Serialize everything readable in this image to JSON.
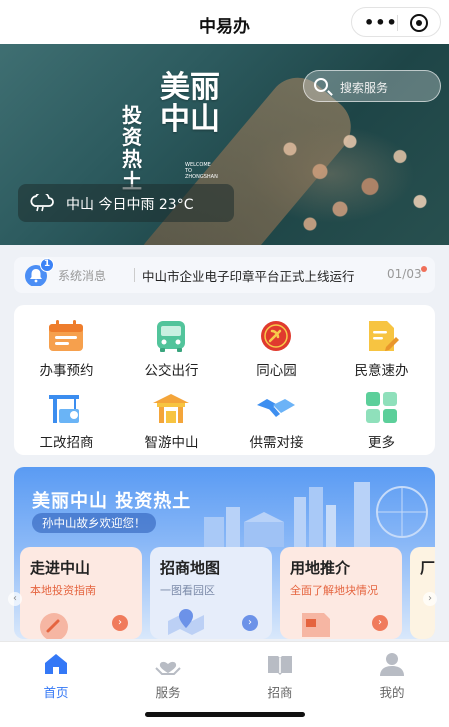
{
  "topbar": {
    "title": "中易办",
    "more_icon": "more-dots-icon",
    "close_icon": "target-circle-icon"
  },
  "hero": {
    "calligraphy_main": "美丽中山",
    "calligraphy_side": "投资热土",
    "welcome_text": "WELCOME TO ZHONGSHAN",
    "search_placeholder": "搜索服务",
    "weather": {
      "icon": "rain-cloud-icon",
      "text": "中山  今日中雨  23°C"
    }
  },
  "notice": {
    "badge": "1",
    "label": "系统消息",
    "text": "中山市企业电子印章平台正式上线运行",
    "page": "01/03",
    "accent": "#f0705a"
  },
  "services": [
    {
      "label": "办事预约",
      "icon": "calendar-icon"
    },
    {
      "label": "公交出行",
      "icon": "bus-icon"
    },
    {
      "label": "同心园",
      "icon": "party-emblem-icon"
    },
    {
      "label": "民意速办",
      "icon": "document-pen-icon"
    },
    {
      "label": "工改招商",
      "icon": "crane-icon"
    },
    {
      "label": "智游中山",
      "icon": "pavilion-icon"
    },
    {
      "label": "供需对接",
      "icon": "handshake-icon"
    },
    {
      "label": "更多",
      "icon": "grid-more-icon"
    }
  ],
  "banner": {
    "title": "美丽中山 投资热土",
    "subtitle": "孙中山故乡欢迎您！",
    "cards": [
      {
        "title": "走进中山",
        "subtitle": "本地投资指南",
        "sub_color": "#e5643f",
        "bg": "#fde9e2",
        "arrow_color": "#f07b5c"
      },
      {
        "title": "招商地图",
        "subtitle": "一图看园区",
        "sub_color": "#7b8aa8",
        "bg": "#e6edfa",
        "arrow_color": "#6c92e8"
      },
      {
        "title": "用地推介",
        "subtitle": "全面了解地块情况",
        "sub_color": "#e5643f",
        "bg": "#fde9e2",
        "arrow_color": "#f07b5c"
      },
      {
        "title": "厂",
        "subtitle": "",
        "sub_color": "#e5643f",
        "bg": "#fdf3e2",
        "arrow_color": "#f0a55c"
      }
    ]
  },
  "tabs": [
    {
      "label": "首页",
      "icon": "home-icon",
      "active": true
    },
    {
      "label": "服务",
      "icon": "service-hands-icon",
      "active": false
    },
    {
      "label": "招商",
      "icon": "investment-book-icon",
      "active": false
    },
    {
      "label": "我的",
      "icon": "user-icon",
      "active": false
    }
  ],
  "colors": {
    "accent": "#3478f6",
    "page_bg": "#eef1f6"
  }
}
